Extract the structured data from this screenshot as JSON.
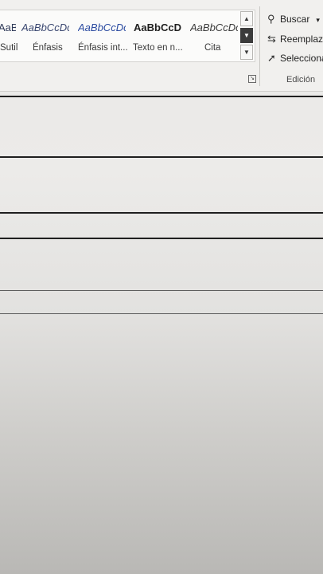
{
  "ribbon": {
    "styles": [
      {
        "sample": "AaBbCcDc",
        "name": "Sutil"
      },
      {
        "sample": "AaBbCcDc",
        "name": "Énfasis"
      },
      {
        "sample": "AaBbCcDc",
        "name": "Énfasis int..."
      },
      {
        "sample": "AaBbCcDc",
        "name": "Texto en n..."
      },
      {
        "sample": "AaBbCcDc",
        "name": "Cita"
      }
    ],
    "editing": {
      "find_label": "Buscar",
      "replace_label": "Reemplazar",
      "select_label": "Seleccionar",
      "group_label": "Edición"
    }
  }
}
